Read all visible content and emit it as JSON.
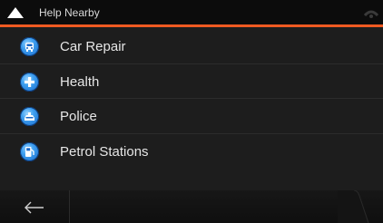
{
  "header": {
    "title": "Help Nearby",
    "accent_color": "#f05a22",
    "left_icon": "up-arrow-icon",
    "right_icon": "signal-icon"
  },
  "items": [
    {
      "label": "Car Repair",
      "icon": "car-repair-icon"
    },
    {
      "label": "Health",
      "icon": "health-cross-icon"
    },
    {
      "label": "Police",
      "icon": "police-icon"
    },
    {
      "label": "Petrol Stations",
      "icon": "fuel-pump-icon"
    }
  ],
  "footer": {
    "back_icon": "back-arrow-icon"
  }
}
